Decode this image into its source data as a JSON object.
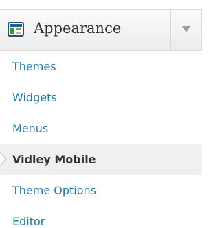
{
  "menu": {
    "title": "Appearance",
    "icon": "appearance-icon",
    "toggle_icon": "triangle-down-icon",
    "items": [
      {
        "label": "Themes",
        "current": false
      },
      {
        "label": "Widgets",
        "current": false
      },
      {
        "label": "Menus",
        "current": false
      },
      {
        "label": "Vidley Mobile",
        "current": true
      },
      {
        "label": "Theme Options",
        "current": false
      },
      {
        "label": "Editor",
        "current": false
      }
    ]
  },
  "colors": {
    "link": "#21759b",
    "current_text": "#333333",
    "current_bg": "#f0f0f0",
    "header_bg": "#f1f1f1"
  }
}
